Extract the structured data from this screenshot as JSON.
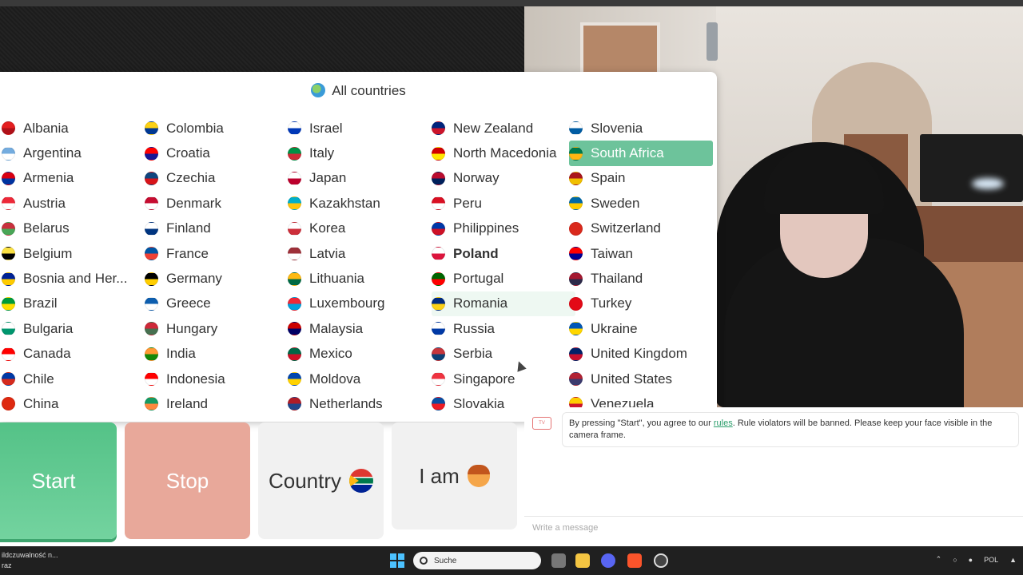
{
  "popup": {
    "title": "All countries",
    "columns": [
      [
        {
          "name": "Albania",
          "c": [
            "#e41e20",
            "#b01018"
          ]
        },
        {
          "name": "Argentina",
          "c": [
            "#74acdf",
            "#ffffff"
          ]
        },
        {
          "name": "Armenia",
          "c": [
            "#d90012",
            "#0033a0"
          ]
        },
        {
          "name": "Austria",
          "c": [
            "#ed2939",
            "#ffffff"
          ]
        },
        {
          "name": "Belarus",
          "c": [
            "#c8313e",
            "#4aa657"
          ]
        },
        {
          "name": "Belgium",
          "c": [
            "#fae042",
            "#000000"
          ]
        },
        {
          "name": "Bosnia and Her...",
          "c": [
            "#002395",
            "#fecb00"
          ]
        },
        {
          "name": "Brazil",
          "c": [
            "#009b3a",
            "#fedf00"
          ]
        },
        {
          "name": "Bulgaria",
          "c": [
            "#ffffff",
            "#00966e"
          ]
        },
        {
          "name": "Canada",
          "c": [
            "#ff0000",
            "#ffffff"
          ]
        },
        {
          "name": "Chile",
          "c": [
            "#0039a6",
            "#d52b1e"
          ]
        },
        {
          "name": "China",
          "c": [
            "#de2910",
            "#de2910"
          ]
        }
      ],
      [
        {
          "name": "Colombia",
          "c": [
            "#fcd116",
            "#003893"
          ]
        },
        {
          "name": "Croatia",
          "c": [
            "#ff0000",
            "#171796"
          ]
        },
        {
          "name": "Czechia",
          "c": [
            "#11457e",
            "#d7141a"
          ]
        },
        {
          "name": "Denmark",
          "c": [
            "#c60c30",
            "#ffffff"
          ]
        },
        {
          "name": "Finland",
          "c": [
            "#ffffff",
            "#003580"
          ]
        },
        {
          "name": "France",
          "c": [
            "#0055a4",
            "#ef4135"
          ]
        },
        {
          "name": "Germany",
          "c": [
            "#000000",
            "#ffce00"
          ]
        },
        {
          "name": "Greece",
          "c": [
            "#0d5eaf",
            "#ffffff"
          ]
        },
        {
          "name": "Hungary",
          "c": [
            "#ce2939",
            "#477050"
          ]
        },
        {
          "name": "India",
          "c": [
            "#ff9933",
            "#138808"
          ]
        },
        {
          "name": "Indonesia",
          "c": [
            "#ff0000",
            "#ffffff"
          ]
        },
        {
          "name": "Ireland",
          "c": [
            "#169b62",
            "#ff883e"
          ]
        }
      ],
      [
        {
          "name": "Israel",
          "c": [
            "#ffffff",
            "#0038b8"
          ]
        },
        {
          "name": "Italy",
          "c": [
            "#009246",
            "#ce2b37"
          ]
        },
        {
          "name": "Japan",
          "c": [
            "#ffffff",
            "#bc002d"
          ]
        },
        {
          "name": "Kazakhstan",
          "c": [
            "#00afca",
            "#fec50c"
          ]
        },
        {
          "name": "Korea",
          "c": [
            "#ffffff",
            "#cd2e3a"
          ]
        },
        {
          "name": "Latvia",
          "c": [
            "#9e3039",
            "#ffffff"
          ]
        },
        {
          "name": "Lithuania",
          "c": [
            "#fdb913",
            "#006a44"
          ]
        },
        {
          "name": "Luxembourg",
          "c": [
            "#ed2939",
            "#00a1de"
          ]
        },
        {
          "name": "Malaysia",
          "c": [
            "#cc0001",
            "#010066"
          ]
        },
        {
          "name": "Mexico",
          "c": [
            "#006847",
            "#ce1126"
          ]
        },
        {
          "name": "Moldova",
          "c": [
            "#0046ae",
            "#ffd200"
          ]
        },
        {
          "name": "Netherlands",
          "c": [
            "#ae1c28",
            "#21468b"
          ]
        }
      ],
      [
        {
          "name": "New Zealand",
          "c": [
            "#00247d",
            "#cc142b"
          ]
        },
        {
          "name": "North Macedonia",
          "c": [
            "#d20000",
            "#ffe600"
          ]
        },
        {
          "name": "Norway",
          "c": [
            "#ba0c2f",
            "#00205b"
          ]
        },
        {
          "name": "Peru",
          "c": [
            "#d91023",
            "#ffffff"
          ]
        },
        {
          "name": "Philippines",
          "c": [
            "#0038a8",
            "#ce1126"
          ]
        },
        {
          "name": "Poland",
          "c": [
            "#ffffff",
            "#dc143c"
          ]
        },
        {
          "name": "Portugal",
          "c": [
            "#006600",
            "#ff0000"
          ]
        },
        {
          "name": "Romania",
          "c": [
            "#002b7f",
            "#fcd116"
          ]
        },
        {
          "name": "Russia",
          "c": [
            "#ffffff",
            "#0039a6"
          ]
        },
        {
          "name": "Serbia",
          "c": [
            "#c6363c",
            "#0c4076"
          ]
        },
        {
          "name": "Singapore",
          "c": [
            "#ef3340",
            "#ffffff"
          ]
        },
        {
          "name": "Slovakia",
          "c": [
            "#0b4ea2",
            "#ee1c25"
          ]
        }
      ],
      [
        {
          "name": "Slovenia",
          "c": [
            "#ffffff",
            "#005da4"
          ]
        },
        {
          "name": "South Africa",
          "c": [
            "#007a4d",
            "#ffb612"
          ]
        },
        {
          "name": "Spain",
          "c": [
            "#aa151b",
            "#f1bf00"
          ]
        },
        {
          "name": "Sweden",
          "c": [
            "#006aa7",
            "#fecc00"
          ]
        },
        {
          "name": "Switzerland",
          "c": [
            "#da291c",
            "#da291c"
          ]
        },
        {
          "name": "Taiwan",
          "c": [
            "#fe0000",
            "#000095"
          ]
        },
        {
          "name": "Thailand",
          "c": [
            "#a51931",
            "#2d2a4a"
          ]
        },
        {
          "name": "Turkey",
          "c": [
            "#e30a17",
            "#e30a17"
          ]
        },
        {
          "name": "Ukraine",
          "c": [
            "#0057b7",
            "#ffd700"
          ]
        },
        {
          "name": "United Kingdom",
          "c": [
            "#012169",
            "#c8102e"
          ]
        },
        {
          "name": "United States",
          "c": [
            "#b22234",
            "#3c3b6e"
          ]
        },
        {
          "name": "Venezuela",
          "c": [
            "#ffcc00",
            "#cf142b"
          ]
        }
      ]
    ],
    "selected": "South Africa",
    "hovered": "Romania",
    "bold": "Poland"
  },
  "buttons": {
    "start": "Start",
    "stop": "Stop",
    "country": "Country",
    "iam": "I am"
  },
  "chat": {
    "logo": "TV",
    "msg_before": "By pressing \"Start\", you agree to our ",
    "msg_link": "rules",
    "msg_after": ". Rule violators will be banned. Please keep your face visible in the camera frame.",
    "input_placeholder": "Write a message"
  },
  "taskbar": {
    "left_line1": "ildczuwalność n...",
    "left_line2": "raz",
    "search_placeholder": "Suche",
    "lang": "POL"
  },
  "colors": {
    "selected_bg": "#6dc39b",
    "start_bg": "#54c287",
    "stop_bg": "#e8a89a"
  }
}
